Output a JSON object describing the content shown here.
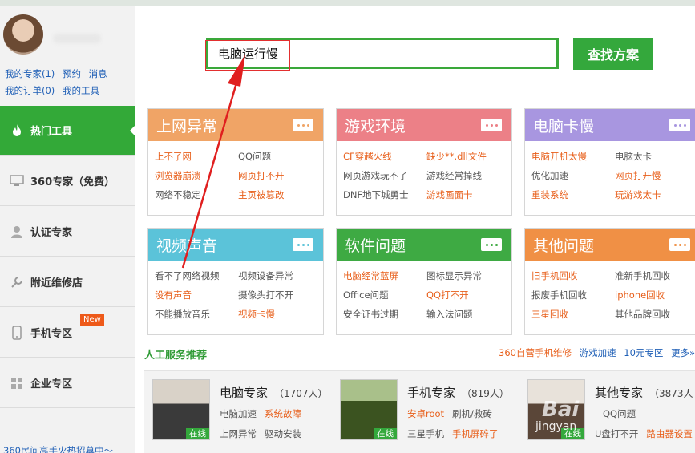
{
  "sidebar": {
    "links_row1": [
      "我的专家(1)",
      "预约",
      "消息"
    ],
    "links_row2": [
      "我的订单(0)",
      "我的工具"
    ],
    "nav": [
      {
        "label": "热门工具",
        "icon": "fire-icon",
        "active": true
      },
      {
        "label": "360专家（免费）",
        "icon": "monitor-icon"
      },
      {
        "label": "认证专家",
        "icon": "person-icon"
      },
      {
        "label": "附近维修店",
        "icon": "wrench-icon"
      },
      {
        "label": "手机专区",
        "icon": "phone-icon",
        "badge": "New"
      },
      {
        "label": "企业专区",
        "icon": "windows-icon"
      }
    ],
    "recruit": "360民间高手火热招募中～"
  },
  "search": {
    "value": "电脑运行慢",
    "button": "查找方案"
  },
  "cards": [
    {
      "title": "上网异常",
      "color": "#f0a466",
      "items": [
        {
          "t": "上不了网",
          "o": true
        },
        {
          "t": "QQ问题",
          "o": false
        },
        {
          "t": "浏览器崩溃",
          "o": true
        },
        {
          "t": "网页打不开",
          "o": true
        },
        {
          "t": "网络不稳定",
          "o": false
        },
        {
          "t": "主页被篡改",
          "o": true
        }
      ]
    },
    {
      "title": "游戏环境",
      "color": "#ec8087",
      "items": [
        {
          "t": "CF穿越火线",
          "o": true
        },
        {
          "t": "缺少**.dll文件",
          "o": true
        },
        {
          "t": "网页游戏玩不了",
          "o": false
        },
        {
          "t": "游戏经常掉线",
          "o": false
        },
        {
          "t": "DNF地下城勇士",
          "o": false
        },
        {
          "t": "游戏画面卡",
          "o": true
        }
      ]
    },
    {
      "title": "电脑卡慢",
      "color": "#a896e0",
      "items": [
        {
          "t": "电脑开机太慢",
          "o": true
        },
        {
          "t": "电脑太卡",
          "o": false
        },
        {
          "t": "优化加速",
          "o": false
        },
        {
          "t": "网页打开慢",
          "o": true
        },
        {
          "t": "重装系统",
          "o": true
        },
        {
          "t": "玩游戏太卡",
          "o": true
        }
      ]
    },
    {
      "title": "视频声音",
      "color": "#5bc3d9",
      "items": [
        {
          "t": "看不了网络视频",
          "o": false
        },
        {
          "t": "视频设备异常",
          "o": false
        },
        {
          "t": "没有声音",
          "o": true
        },
        {
          "t": "摄像头打不开",
          "o": false
        },
        {
          "t": "不能播放音乐",
          "o": false
        },
        {
          "t": "视频卡慢",
          "o": true
        }
      ]
    },
    {
      "title": "软件问题",
      "color": "#3eaa43",
      "items": [
        {
          "t": "电脑经常蓝屏",
          "o": true
        },
        {
          "t": "图标显示异常",
          "o": false
        },
        {
          "t": "Office问题",
          "o": false
        },
        {
          "t": "QQ打不开",
          "o": true
        },
        {
          "t": "安全证书过期",
          "o": false
        },
        {
          "t": "输入法问题",
          "o": false
        }
      ]
    },
    {
      "title": "其他问题",
      "color": "#f09045",
      "items": [
        {
          "t": "旧手机回收",
          "o": true
        },
        {
          "t": "准新手机回收",
          "o": false
        },
        {
          "t": "报废手机回收",
          "o": false
        },
        {
          "t": "iphone回收",
          "o": true
        },
        {
          "t": "三星回收",
          "o": true
        },
        {
          "t": "其他品牌回收",
          "o": false
        }
      ]
    }
  ],
  "section": {
    "title": "人工服务推荐",
    "links": [
      {
        "t": "360自营手机维修",
        "o": true
      },
      {
        "t": "游戏加速",
        "o": false
      },
      {
        "t": "10元专区",
        "o": false
      },
      {
        "t": "更多»",
        "o": false
      }
    ]
  },
  "experts": [
    {
      "name": "电脑专家",
      "count": "（1707人）",
      "online": "在线",
      "row1": [
        {
          "t": "电脑加速",
          "o": false
        },
        {
          "t": "系统故障",
          "o": true
        }
      ],
      "row2": [
        {
          "t": "上网异常",
          "o": false
        },
        {
          "t": "驱动安装",
          "o": false
        }
      ]
    },
    {
      "name": "手机专家",
      "count": "（819人）",
      "online": "在线",
      "row1": [
        {
          "t": "安卓root",
          "o": true
        },
        {
          "t": "刷机/救砖",
          "o": false
        }
      ],
      "row2": [
        {
          "t": "三星手机",
          "o": false
        },
        {
          "t": "手机屏碎了",
          "o": true
        }
      ]
    },
    {
      "name": "其他专家",
      "count": "（3873人",
      "online": "在线",
      "row1": [
        {
          "t": "",
          "o": false
        },
        {
          "t": "QQ问题",
          "o": false
        }
      ],
      "row2": [
        {
          "t": "U盘打不开",
          "o": false
        },
        {
          "t": "路由器设置",
          "o": true
        }
      ]
    }
  ],
  "watermark": {
    "text": "Bai",
    "sub": "jingyan"
  }
}
